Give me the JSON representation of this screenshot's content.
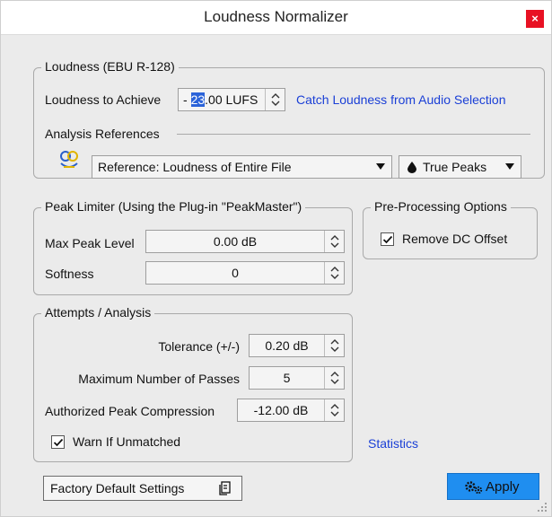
{
  "window": {
    "title": "Loudness Normalizer",
    "close_glyph": "×"
  },
  "loudness": {
    "group_title": "Loudness (EBU R-128)",
    "target_label": "Loudness to Achieve",
    "target_value_prefix": "- ",
    "target_value_selected": "23",
    "target_value_suffix": ".00 LUFS",
    "catch_link": "Catch Loudness from Audio Selection",
    "analysis_title": "Analysis References",
    "reference_icon": "reference-logo-icon",
    "reference_selected": "Reference: Loudness of Entire File",
    "peaks_selected": "True Peaks",
    "peaks_icon": "drop-icon"
  },
  "peak_limiter": {
    "group_title": "Peak Limiter (Using the Plug-in \"PeakMaster\")",
    "max_peak_label": "Max Peak Level",
    "max_peak_value": "0.00 dB",
    "softness_label": "Softness",
    "softness_value": "0"
  },
  "preprocessing": {
    "group_title": "Pre-Processing Options",
    "remove_dc_label": "Remove DC Offset",
    "remove_dc_checked": true
  },
  "attempts": {
    "group_title": "Attempts / Analysis",
    "tolerance_label": "Tolerance (+/-)",
    "tolerance_value": "0.20 dB",
    "passes_label": "Maximum Number of Passes",
    "passes_value": "5",
    "compression_label": "Authorized Peak Compression",
    "compression_value": "-12.00 dB",
    "warn_label": "Warn If Unmatched",
    "warn_checked": true
  },
  "statistics_link": "Statistics",
  "footer": {
    "factory_label": "Factory Default Settings",
    "factory_icon": "preset-icon",
    "apply_label": "Apply",
    "apply_icon": "gears-icon"
  },
  "colors": {
    "link": "#1a3fd6",
    "apply": "#1f8ef0",
    "close": "#e81123"
  }
}
